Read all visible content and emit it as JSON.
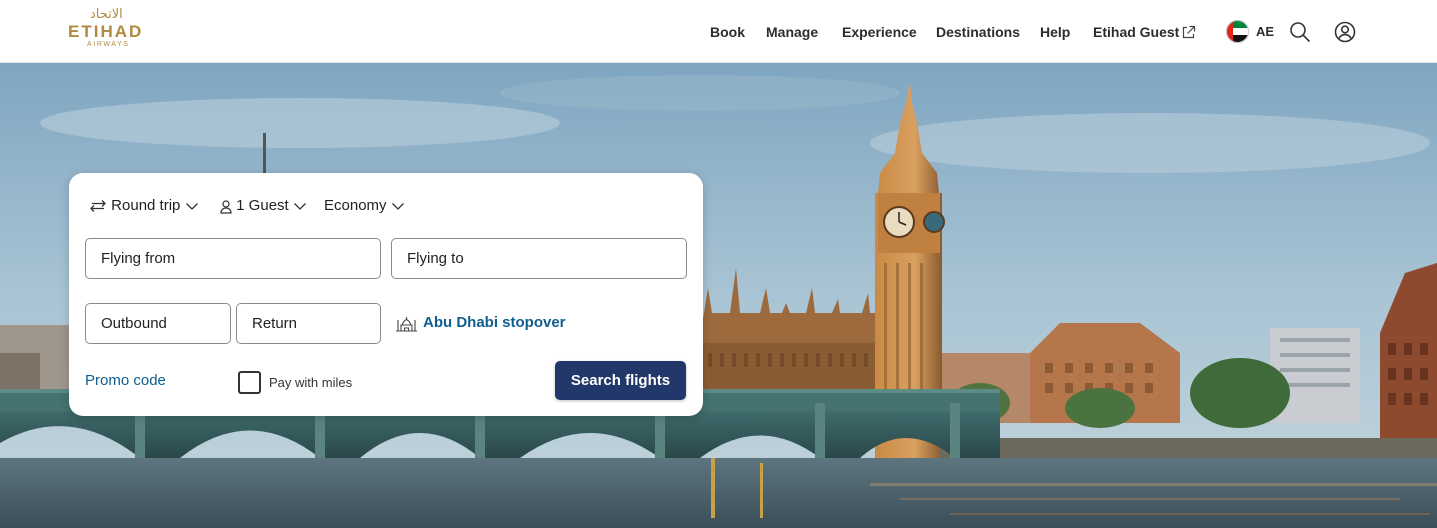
{
  "brand": {
    "arabic_name": "الاتحاد",
    "name": "ETIHAD",
    "subname": "AIRWAYS",
    "gold": "#b08a3e",
    "navy": "#23386a",
    "link_blue": "#0f5e8f"
  },
  "nav": {
    "items": [
      {
        "label": "Book"
      },
      {
        "label": "Manage"
      },
      {
        "label": "Experience"
      },
      {
        "label": "Destinations"
      },
      {
        "label": "Help"
      },
      {
        "label": "Etihad Guest",
        "icon": "external-link-icon"
      }
    ],
    "country_code": "AE",
    "flag": "uae-flag-icon",
    "search_icon": "search-icon",
    "account_icon": "user-account-icon"
  },
  "hero": {
    "scene": "london-big-ben-westminster-bridge-photo"
  },
  "booking": {
    "trip_type": {
      "label": "Round trip",
      "icon": "swap-arrows-icon"
    },
    "guests": {
      "label": "1 Guest",
      "icon": "person-icon"
    },
    "cabin": {
      "label": "Economy"
    },
    "flying_from": "Flying from",
    "flying_to": "Flying to",
    "outbound": "Outbound",
    "return": "Return",
    "stopover": {
      "label": "Abu Dhabi stopover",
      "icon": "mosque-icon"
    },
    "promo_code": "Promo code",
    "pay_with_miles": "Pay with miles",
    "search_button": "Search flights"
  }
}
